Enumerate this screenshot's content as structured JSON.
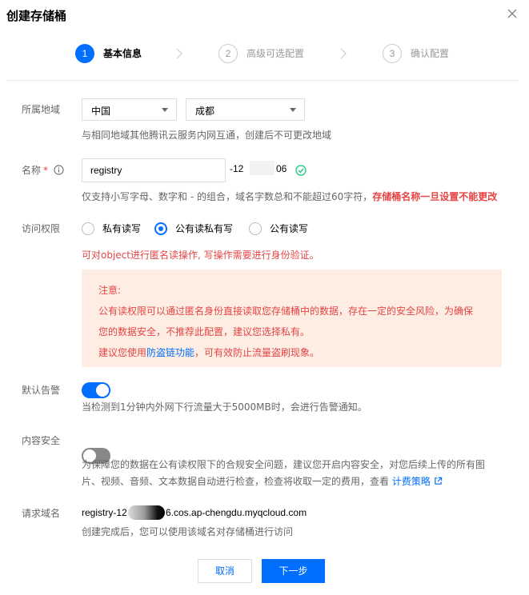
{
  "dialog": {
    "title": "创建存储桶"
  },
  "steps": [
    {
      "num": "1",
      "label": "基本信息",
      "active": true
    },
    {
      "num": "2",
      "label": "高级可选配置",
      "active": false
    },
    {
      "num": "3",
      "label": "确认配置",
      "active": false
    }
  ],
  "region": {
    "label": "所属地域",
    "country": "中国",
    "city": "成都",
    "hint": "与相同地域其他腾讯云服务内网互通，创建后不可更改地域"
  },
  "name": {
    "label": "名称",
    "required_mark": "*",
    "value": "registry",
    "suffix_prefix": "-12",
    "suffix_end": "06",
    "hint_prefix": "仅支持小写字母、数字和 - 的组合，域名字数总和不能超过60字符，",
    "hint_warning": "存储桶名称一旦设置不能更改"
  },
  "access": {
    "label": "访问权限",
    "options": [
      "私有读写",
      "公有读私有写",
      "公有读写"
    ],
    "selected": "公有读私有写",
    "notice": "可对object进行匿名读操作, 写操作需要进行身份验证。"
  },
  "warning": {
    "title": "注意:",
    "line1": "公有读权限可以通过匿名身份直接读取您存储桶中的数据，存在一定的安全风险，为确保",
    "line2": "您的数据安全，不推荐此配置，建议您选择私有。",
    "line3_prefix": "建议您使用",
    "line3_link": "防盗链功能",
    "line3_suffix": "，可有效防止流量盗刷现象。"
  },
  "alert": {
    "label": "默认告警",
    "enabled": true,
    "hint": "当检测到1分钟内外网下行流量大于5000MB时，会进行告警通知。"
  },
  "content_security": {
    "label": "内容安全",
    "enabled": false,
    "hint_line1": "为保障您的数据在公有读权限下的合规安全问题，建议您开启内容安全，对您后续上传的所有图",
    "hint_line2_prefix": "片、视频、音频、文本数据自动进行检查，检查将收取一定的费用，查看",
    "link": "计费策略"
  },
  "domain": {
    "label": "请求域名",
    "prefix": "registry-12",
    "suffix": "6.cos.ap-chengdu.myqcloud.com",
    "hint": "创建完成后，您可以使用该域名对存储桶进行访问"
  },
  "footer": {
    "cancel": "取消",
    "next": "下一步"
  },
  "colors": {
    "primary": "#006eff",
    "danger": "#e54545",
    "warning_bg": "#fdede3",
    "success": "#29cc85"
  }
}
